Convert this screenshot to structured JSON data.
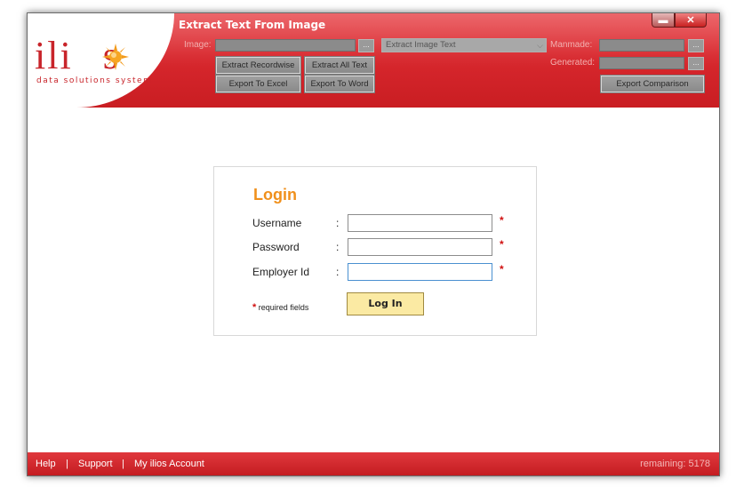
{
  "window": {
    "title": "Extract Text From Image",
    "minimize_glyph": "▬",
    "close_glyph": "✕"
  },
  "logo": {
    "letters_left": "ili",
    "letters_right": "s",
    "tagline": "data solutions system"
  },
  "toolbar": {
    "image_label": "Image:",
    "browse_label": "...",
    "extract_recordwise": "Extract Recordwise",
    "extract_all_text": "Extract All Text",
    "export_excel": "Export To Excel",
    "export_word": "Export To Word",
    "mode_select": "Extract Image Text",
    "manmade_label": "Manmade:",
    "generated_label": "Generated:",
    "export_comparison": "Export Comparison"
  },
  "login": {
    "title": "Login",
    "username_label": "Username",
    "password_label": "Password",
    "employer_label": "Employer Id",
    "colon": ":",
    "required_star": "*",
    "required_text": "required fields",
    "username_value": "",
    "password_value": "",
    "employer_value": "",
    "button": "Log In"
  },
  "footer": {
    "help": "Help",
    "support": "Support",
    "account": "My ilios Account",
    "separator": "|",
    "remaining": "remaining: 5178"
  },
  "colors": {
    "brand_red": "#d8282e",
    "accent_orange": "#f0901c",
    "button_yellow": "#fbeaa3"
  }
}
